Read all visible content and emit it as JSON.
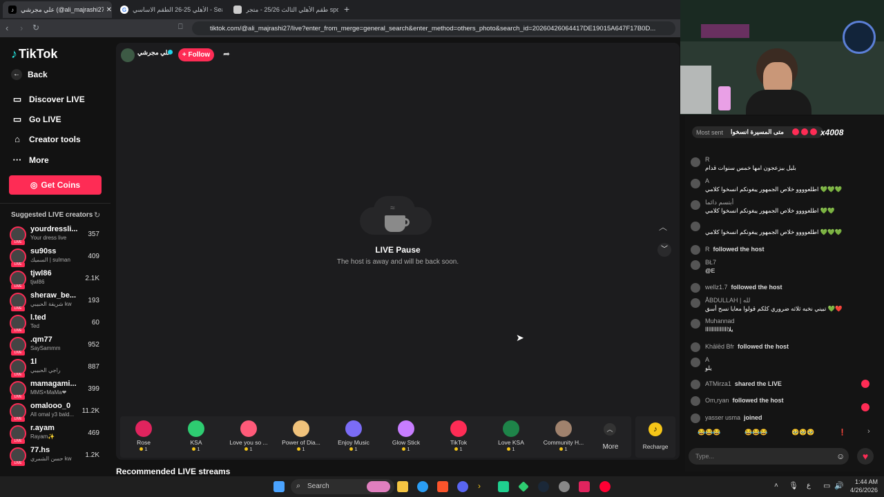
{
  "browser": {
    "tabs": [
      {
        "label": "علي مجرشي (@ali_majrashi27) LIVE",
        "active": true
      },
      {
        "label": "الأهلي 25-26 الطقم الاساسي - Search",
        "active": false
      },
      {
        "label": "طقم الأهلي الثالث 25/26 - متجر sport",
        "active": false
      }
    ],
    "new_tab": "+",
    "url": "tiktok.com/@ali_majrashi27/live?enter_from_merge=general_search&enter_method=others_photo&search_id=20260426064417DE19015A647F17B0D..."
  },
  "sidebar": {
    "logo": "TikTok",
    "nav": [
      {
        "label": "Back",
        "icon": "arrow-left-icon"
      },
      {
        "label": "Discover LIVE",
        "icon": "live-screen-icon"
      },
      {
        "label": "Go LIVE",
        "icon": "camera-icon"
      },
      {
        "label": "Creator tools",
        "icon": "home-icon"
      },
      {
        "label": "More",
        "icon": "ellipsis-icon"
      }
    ],
    "get_coins": "Get Coins",
    "suggested_title": "Suggested LIVE creators",
    "live_badge": "LIVE",
    "creators": [
      {
        "name": "yourdressli...",
        "sub": "Your dress live",
        "count": "357"
      },
      {
        "name": "su90ss",
        "sub": "السميك | sulman",
        "count": "409"
      },
      {
        "name": "tjwl86",
        "sub": "tjwl86",
        "count": "2.1K"
      },
      {
        "name": "sheraw_be...",
        "sub": "شريفة الحبيبي kw",
        "count": "193"
      },
      {
        "name": "l.ted",
        "sub": "Ted",
        "count": "60"
      },
      {
        "name": ".qm77",
        "sub": "SaySammm",
        "count": "952"
      },
      {
        "name": "1l",
        "sub": "راجي الحبيبي",
        "count": "887"
      },
      {
        "name": "mamagami...",
        "sub": "MMS×MaMa❤",
        "count": "399"
      },
      {
        "name": "omalooo_0",
        "sub": "All omal y3 bald...",
        "count": "11.2K"
      },
      {
        "name": "r.ayam",
        "sub": "Rayam✨",
        "count": "469"
      },
      {
        "name": "77.hs",
        "sub": "حسن الشمري kw",
        "count": "1.2K"
      }
    ]
  },
  "stream": {
    "host_name": "علي مجرشي",
    "follow": "+ Follow",
    "pause_title": "LIVE Pause",
    "pause_sub": "The host is away and will be back soon.",
    "recommended": "Recommended LIVE streams"
  },
  "gifts": [
    {
      "label": "Rose",
      "price": "1",
      "color": "#e0245e"
    },
    {
      "label": "KSA",
      "price": "1",
      "color": "#2ecc71"
    },
    {
      "label": "Love you so ...",
      "price": "1",
      "color": "#ff5a79"
    },
    {
      "label": "Power of Dia...",
      "price": "1",
      "color": "#f0c27b"
    },
    {
      "label": "Enjoy Music",
      "price": "1",
      "color": "#7b6cf6"
    },
    {
      "label": "Glow Stick",
      "price": "1",
      "color": "#c77dff"
    },
    {
      "label": "TikTok",
      "price": "1",
      "color": "#fe2c55"
    },
    {
      "label": "Love KSA",
      "price": "1",
      "color": "#1e8449"
    },
    {
      "label": "Community H...",
      "price": "1",
      "color": "#a0826d"
    }
  ],
  "gift_more": "More",
  "recharge": "Recharge",
  "chat": {
    "most_sent_label": "Most sent",
    "most_sent_text": "متى المسيرة انسخوا",
    "most_sent_count": "x4008",
    "messages": [
      {
        "user": "R",
        "text": "بليل بيزعجون امها خمس سنوات قدام"
      },
      {
        "user": "A",
        "text": "اطلعوووو خلاص الجمهور يبغونكم انسخوا كلامي 💚💚💚"
      },
      {
        "user": "أبتسم دائما",
        "text": "اطلعوووو خلاص الجمهور يبغونكم انسخوا كلامي 💚💚"
      },
      {
        "user": "",
        "text": "اطلعوووو خلاص الجمهور يبغونكم انسخوا كلامي 💚💚💚"
      }
    ],
    "events": [
      {
        "user": "R",
        "action": "followed the host"
      },
      {
        "user": "BŁ7",
        "action": "@E",
        "two_line": true
      },
      {
        "user": "wellz1.7",
        "action": "followed the host"
      },
      {
        "user": "ÅBDULLAH | لله",
        "action": "تبيني نخبه ثلاثه ضروري كلكم قولوا معايا نسح أسق 💚❤️",
        "two_line": true
      },
      {
        "user": "Muhannad",
        "action": "يلااااااااااااااا",
        "two_line": true
      },
      {
        "user": "Khālēd Bfr",
        "action": "followed the host"
      },
      {
        "user": "A",
        "action": "يلو",
        "two_line": true
      },
      {
        "user": "ATMirza1",
        "action": "shared the LIVE"
      },
      {
        "user": "Om,ryan",
        "action": "followed the host"
      },
      {
        "user": "yasser usma",
        "action": "joined"
      }
    ],
    "input_placeholder": "Type..."
  },
  "taskbar": {
    "search": "Search",
    "time": "1:44 AM",
    "date": "4/26/2026",
    "lang": "ع"
  }
}
